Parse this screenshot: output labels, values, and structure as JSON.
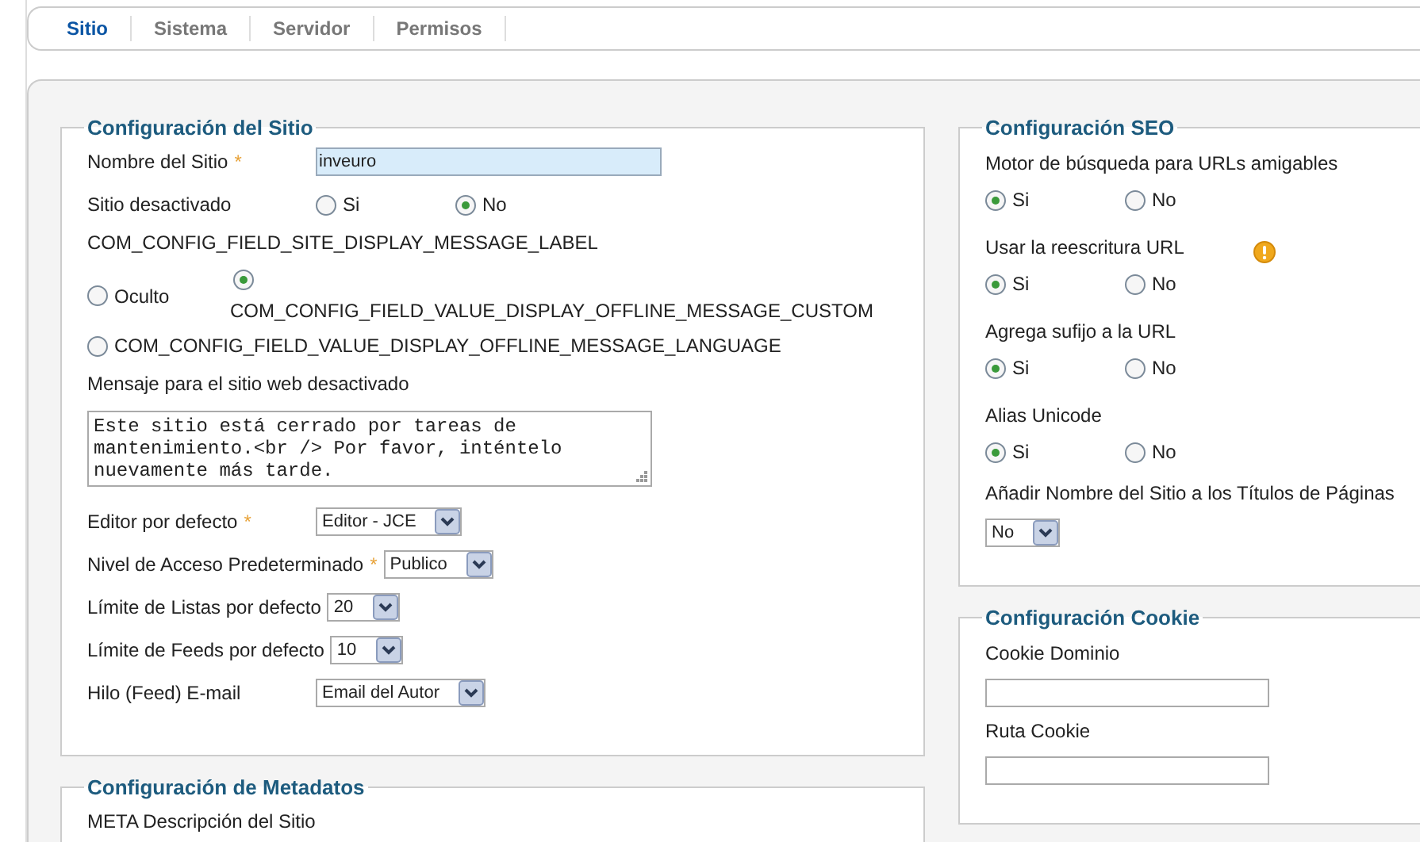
{
  "tabs": [
    {
      "label": "Sitio",
      "selected": true
    },
    {
      "label": "Sistema",
      "selected": false
    },
    {
      "label": "Servidor",
      "selected": false
    },
    {
      "label": "Permisos",
      "selected": false
    }
  ],
  "left_column": [
    {
      "title": "Configuración del Sitio",
      "fields": [
        {
          "kind": "text",
          "label": "Nombre del Sitio",
          "required_mark": "*",
          "value": "inveuro",
          "focused": true
        },
        {
          "kind": "radio",
          "label": "Sitio desactivado",
          "options": [
            {
              "label": "Si",
              "selected": false
            },
            {
              "label": "No",
              "selected": true
            }
          ]
        },
        {
          "kind": "radio_wrap",
          "label": "COM_CONFIG_FIELD_SITE_DISPLAY_MESSAGE_LABEL",
          "options": [
            {
              "label": "Oculto",
              "selected": false,
              "label_below": false
            },
            {
              "label": "COM_CONFIG_FIELD_VALUE_DISPLAY_OFFLINE_MESSAGE_CUSTOM",
              "selected": true,
              "label_below": true
            },
            {
              "label": "COM_CONFIG_FIELD_VALUE_DISPLAY_OFFLINE_MESSAGE_LANGUAGE",
              "selected": false,
              "label_below": false
            }
          ]
        },
        {
          "kind": "textarea",
          "label": "Mensaje para el sitio web desactivado",
          "value": "Este sitio está cerrado por tareas de mantenimiento.<br /> Por favor, inténtelo nuevamente más tarde."
        },
        {
          "kind": "select",
          "label": "Editor por defecto",
          "required_mark": "*",
          "value": "Editor - JCE"
        },
        {
          "kind": "select",
          "label": "Nivel de Acceso Predeterminado",
          "required_mark": "*",
          "value": "Publico"
        },
        {
          "kind": "select",
          "label": "Límite de Listas por defecto",
          "value": "20"
        },
        {
          "kind": "select",
          "label": "Límite de Feeds por defecto",
          "value": "10"
        },
        {
          "kind": "select",
          "label": "Hilo (Feed) E-mail",
          "value": "Email del Autor"
        }
      ]
    },
    {
      "title": "Configuración de Metadatos",
      "fields": [
        {
          "kind": "label",
          "label": "META Descripción del Sitio"
        }
      ]
    }
  ],
  "right_column": [
    {
      "title": "Configuración SEO",
      "fields": [
        {
          "kind": "radio_stacked",
          "label": "Motor de búsqueda para URLs amigables",
          "warning": false,
          "options": [
            {
              "label": "Si",
              "selected": true
            },
            {
              "label": "No",
              "selected": false
            }
          ]
        },
        {
          "kind": "radio_stacked",
          "label": "Usar la reescritura URL",
          "warning": true,
          "options": [
            {
              "label": "Si",
              "selected": true
            },
            {
              "label": "No",
              "selected": false
            }
          ]
        },
        {
          "kind": "radio_stacked",
          "label": "Agrega sufijo a la URL",
          "warning": false,
          "options": [
            {
              "label": "Si",
              "selected": true
            },
            {
              "label": "No",
              "selected": false
            }
          ]
        },
        {
          "kind": "radio_stacked",
          "label": "Alias Unicode",
          "warning": false,
          "options": [
            {
              "label": "Si",
              "selected": true
            },
            {
              "label": "No",
              "selected": false
            }
          ]
        },
        {
          "kind": "select_stacked",
          "label": "Añadir Nombre del Sitio a los Títulos de Páginas",
          "value": "No"
        }
      ]
    },
    {
      "title": "Configuración Cookie",
      "fields": [
        {
          "kind": "text_stacked",
          "label": "Cookie Dominio"
        },
        {
          "kind": "text_stacked",
          "label": "Ruta Cookie"
        }
      ]
    }
  ]
}
